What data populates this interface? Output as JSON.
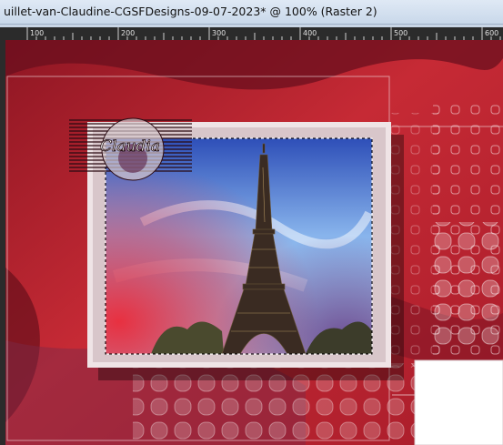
{
  "window": {
    "title": "uillet-van-Claudine-CGSFDesigns-09-07-2023* @ 100% (Raster 2)"
  },
  "ruler": {
    "labels": [
      "100",
      "200",
      "300",
      "400",
      "500",
      "600"
    ]
  },
  "canvas": {
    "watermark_text": "Claudia",
    "selection": "marching-ants-rectangle",
    "image_subject": "eiffel-tower"
  },
  "colors": {
    "background_red": "#b3232e",
    "dark_red": "#6a0f1e",
    "frame_light": "#efe4e6",
    "sky_blue": "#3a63c8"
  },
  "icons": {
    "watermark": "claudia-logo-icon"
  }
}
